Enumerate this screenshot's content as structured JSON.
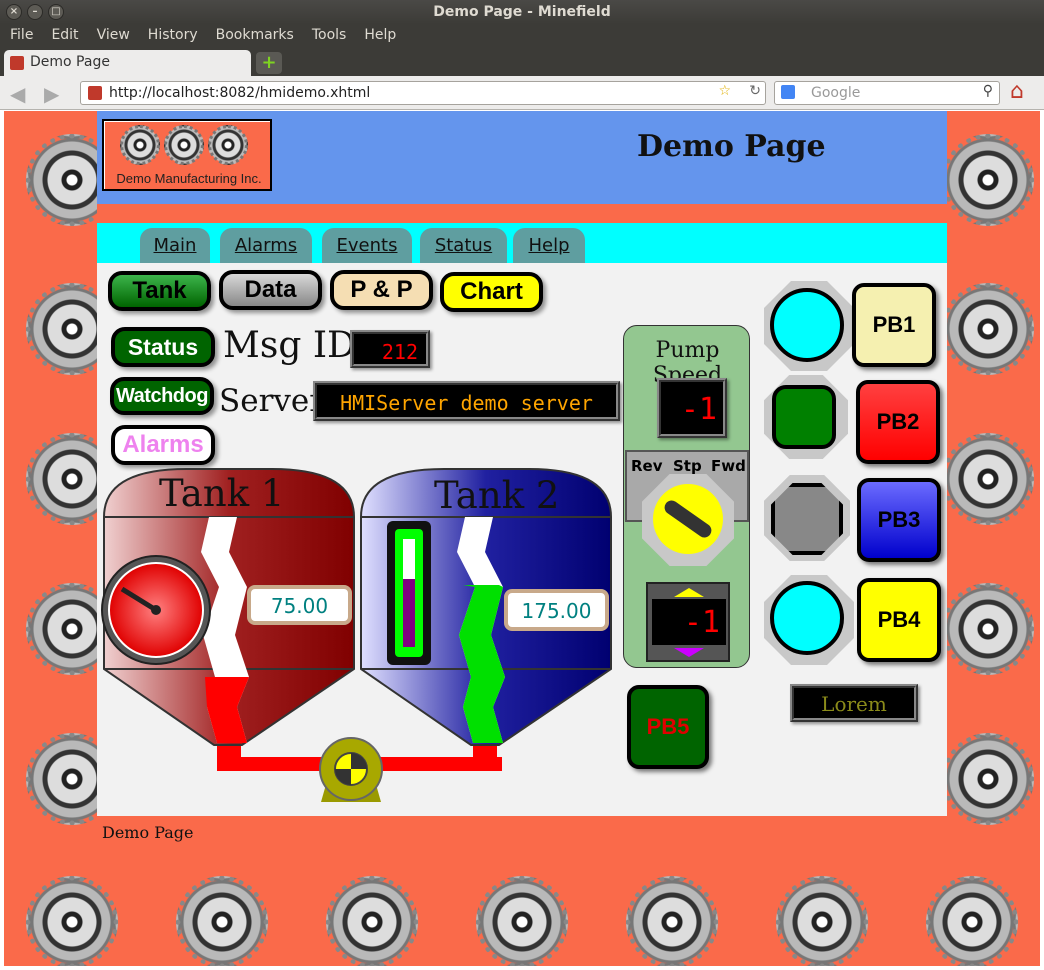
{
  "window": {
    "title": "Demo Page - Minefield"
  },
  "menu": [
    "File",
    "Edit",
    "View",
    "History",
    "Bookmarks",
    "Tools",
    "Help"
  ],
  "tab": {
    "label": "Demo Page"
  },
  "address": {
    "url": "http://localhost:8082/hmidemo.xhtml"
  },
  "search": {
    "placeholder": "Google"
  },
  "page": {
    "company": "Demo Manufacturing Inc.",
    "title": "Demo Page",
    "nav_tabs": [
      "Main",
      "Alarms",
      "Events",
      "Status",
      "Help"
    ],
    "view_buttons": [
      "Tank",
      "Data",
      "P & P",
      "Chart"
    ],
    "status_button": "Status",
    "watchdog_button": "Watchdog",
    "alarms_button": "Alarms",
    "msg_id_label": "Msg ID",
    "msg_id_value": "212",
    "server_id_label": "Server ID",
    "server_id_value": "HMIServer demo server",
    "tank1": {
      "title": "Tank 1",
      "value": "75.00"
    },
    "tank2": {
      "title": "Tank 2",
      "value": "175.00"
    },
    "pump_speed": {
      "label": "Pump Speed",
      "display": "-1",
      "dial_labels": [
        "Rev",
        "Stp",
        "Fwd"
      ],
      "stepper_value": "-1"
    },
    "pushbuttons": [
      "PB1",
      "PB2",
      "PB3",
      "PB4",
      "PB5"
    ],
    "lorem": "Lorem",
    "footer": "Demo Page"
  },
  "colors": {
    "background": "#fa6a4a",
    "header": "#6495ed",
    "nav": "#00ffff",
    "tab": "#5f9ea0"
  }
}
